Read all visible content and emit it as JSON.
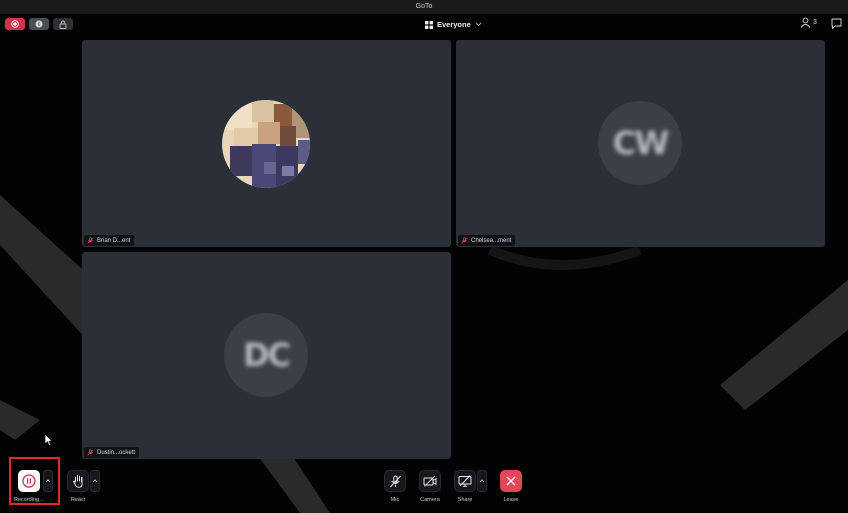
{
  "window": {
    "title": "GoTo"
  },
  "topbar": {
    "view_label": "Everyone",
    "participant_count": "3"
  },
  "tiles": [
    {
      "name": "Brian D...ent",
      "avatar_type": "photo",
      "mic_state": "muted"
    },
    {
      "name": "Chelsea...ment",
      "initials": "CW",
      "mic_state": "muted"
    },
    {
      "name": "Dustin...ockett",
      "initials": "DC",
      "mic_state": "muted"
    }
  ],
  "controls": {
    "recording": "Recording...",
    "react": "React",
    "mic": "Mic",
    "camera": "Camera",
    "share": "Share",
    "leave": "Leave"
  },
  "colors": {
    "background": "#030303",
    "tile": "#2b2f37",
    "record_red": "#d3324b",
    "leave_red": "#e0475a",
    "highlight": "#e3262e"
  },
  "icons": [
    "record-icon",
    "info-icon",
    "lock-icon",
    "grid-icon",
    "chevron-down-icon",
    "person-icon",
    "chat-icon",
    "mic-off-icon",
    "pause-icon",
    "hand-icon",
    "camera-off-icon",
    "share-off-icon",
    "close-icon",
    "cursor-icon"
  ]
}
